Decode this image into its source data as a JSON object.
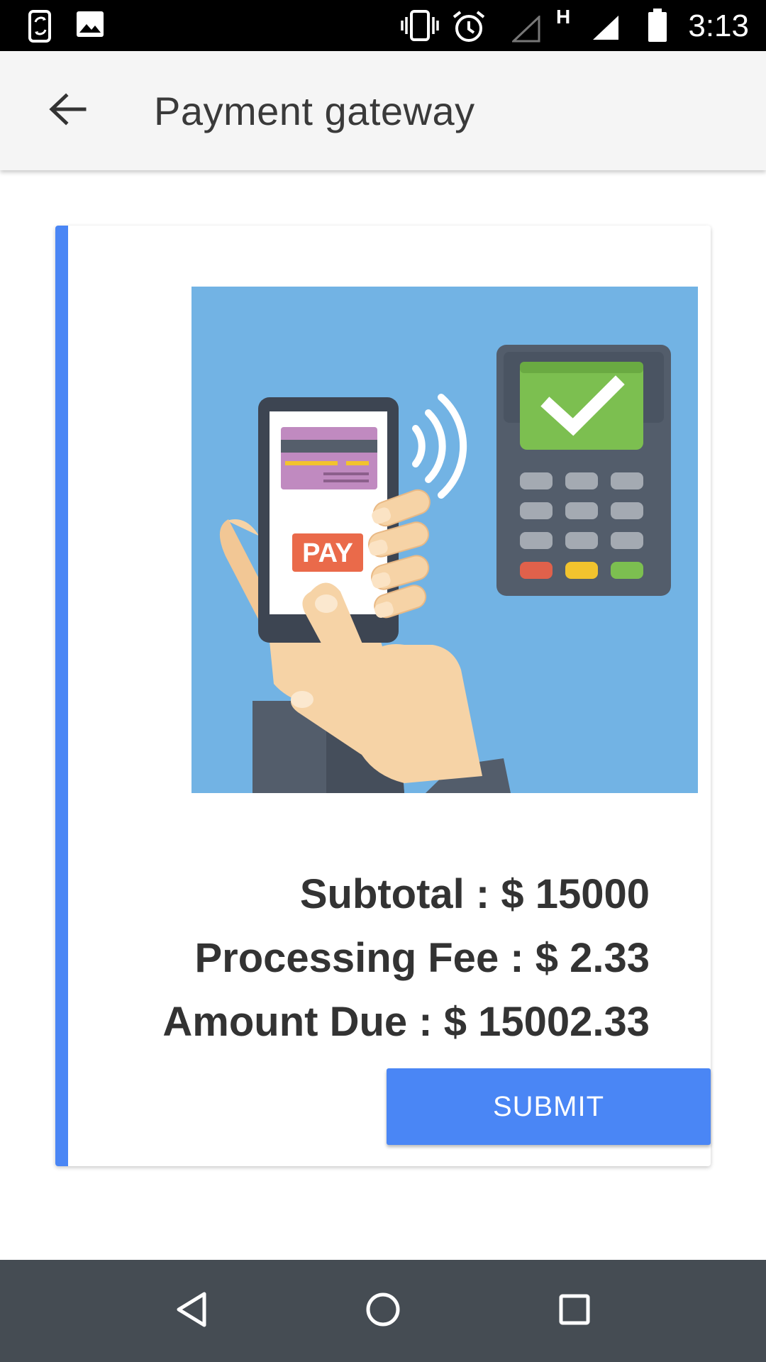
{
  "status_bar": {
    "time": "3:13",
    "network_label": "H",
    "icons": [
      "screen-rotation-icon",
      "image-icon",
      "vibrate-icon",
      "alarm-icon",
      "no-signal-icon",
      "signal-icon",
      "battery-icon"
    ]
  },
  "app_bar": {
    "title": "Payment gateway",
    "back_icon": "arrow-back-icon"
  },
  "card": {
    "accent_color": "#4a86f5",
    "illustration": {
      "icon": "mobile-payment-illustration",
      "phone_button_label": "PAY"
    },
    "summary": {
      "subtotal": "Subtotal : $ 15000",
      "processing_fee": "Processing Fee : $ 2.33",
      "amount_due": "Amount Due : $ 15002.33"
    },
    "submit_label": "SUBMIT"
  },
  "nav_bar": {
    "icons": [
      "nav-back-icon",
      "nav-home-icon",
      "nav-recents-icon"
    ]
  },
  "colors": {
    "status_bar": "#000000",
    "app_bar": "#f5f5f5",
    "accent": "#4a86f5",
    "nav_bar": "#454c53",
    "illustration_bg": "#72b3e4"
  }
}
